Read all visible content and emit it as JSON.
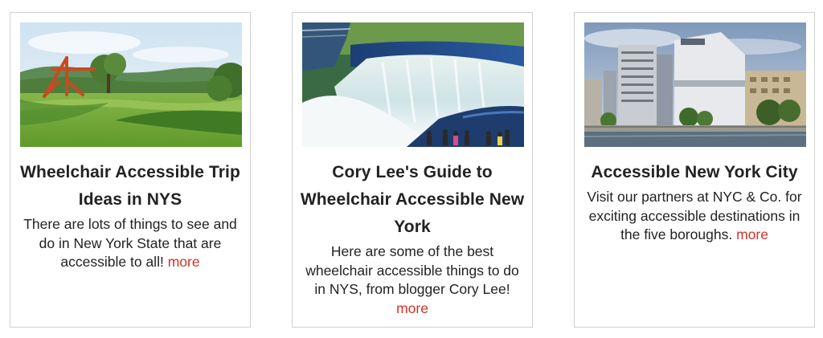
{
  "cards": [
    {
      "title": "Wheelchair Accessible Trip Ideas in NYS",
      "text": "There are lots of things to see and do in New York State that are accessible to all!",
      "more_label": "more",
      "image_subject": "landscape-sculpture-field"
    },
    {
      "title": "Cory Lee's Guide to Wheelchair Accessible New York",
      "text": "Here are some of the best wheelchair accessible things to do in NYS, from blogger Cory Lee!",
      "more_label": "more",
      "image_subject": "niagara-falls"
    },
    {
      "title": "Accessible New York City",
      "text": "Visit our partners at NYC & Co. for exciting accessible destinations in the five boroughs.",
      "more_label": "more",
      "image_subject": "city-waterfront-buildings"
    }
  ],
  "colors": {
    "link": "#d0332a",
    "text": "#222222",
    "border": "#d0d0d0"
  }
}
